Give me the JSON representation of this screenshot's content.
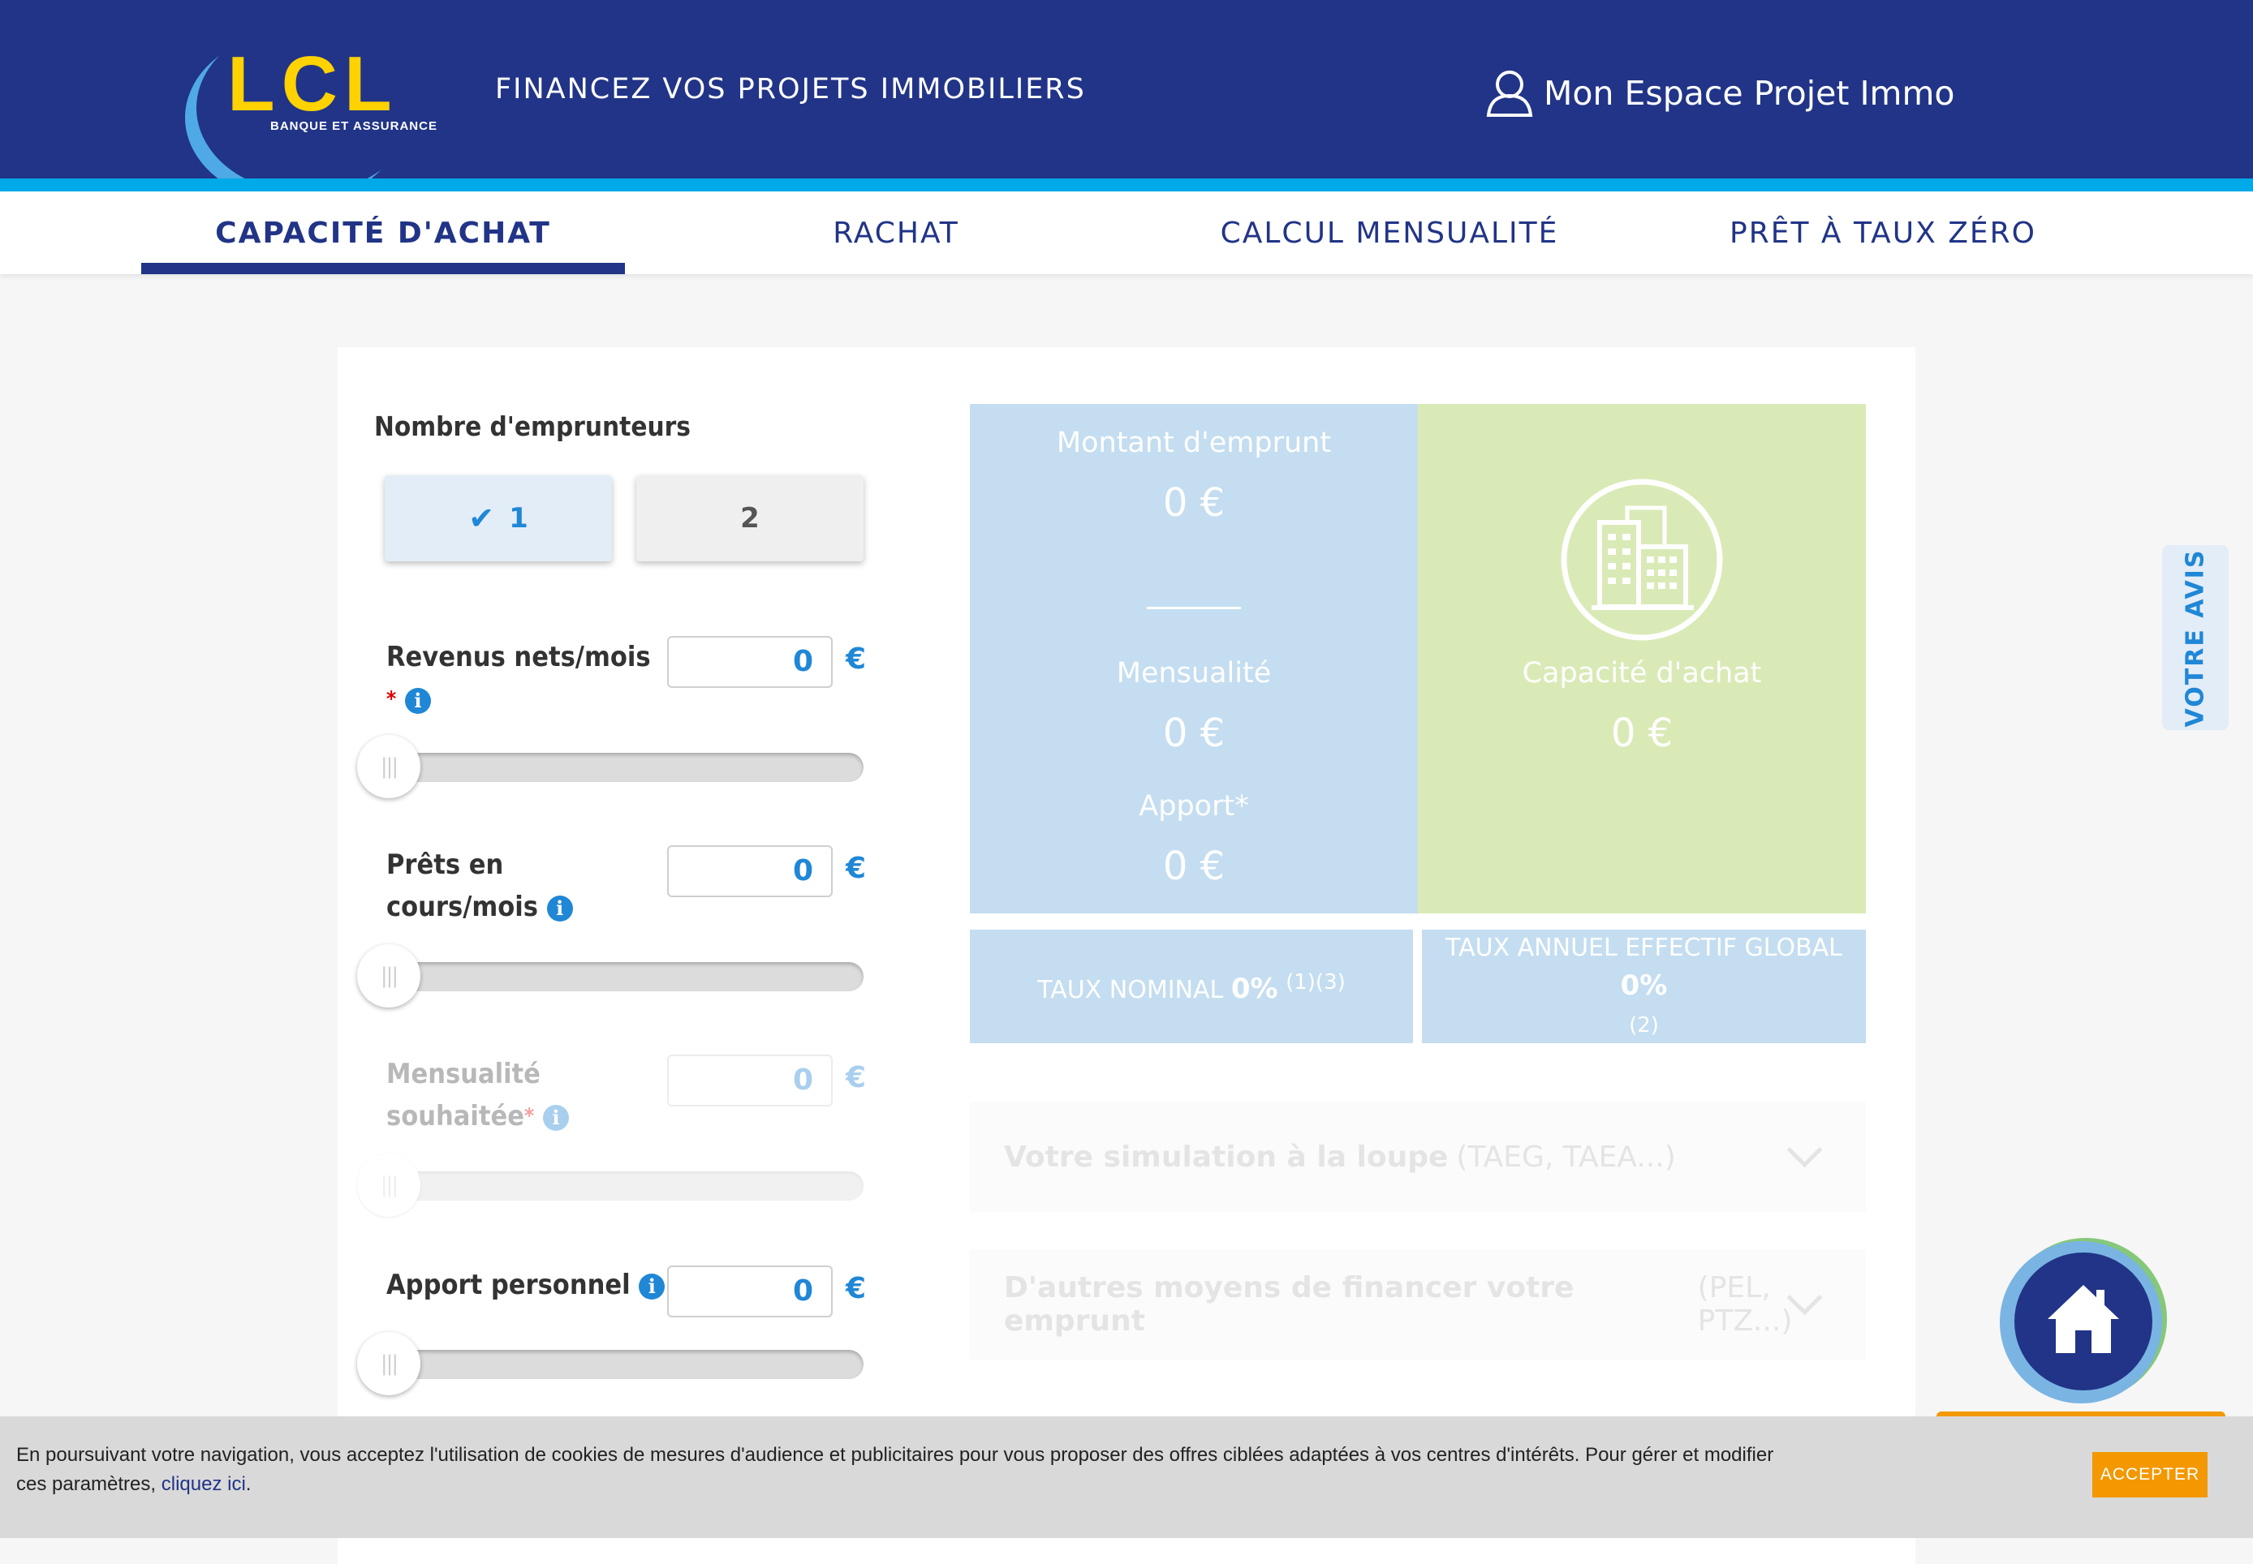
{
  "header": {
    "logo_text": "LCL",
    "logo_subtitle": "BANQUE ET ASSURANCE",
    "title": "FINANCEZ VOS PROJETS IMMOBILIERS",
    "account_link": "Mon Espace Projet Immo"
  },
  "tabs": [
    {
      "label": "CAPACITÉ D'ACHAT",
      "active": true
    },
    {
      "label": "RACHAT",
      "active": false
    },
    {
      "label": "CALCUL MENSUALITÉ",
      "active": false
    },
    {
      "label": "PRÊT À TAUX ZÉRO",
      "active": false
    }
  ],
  "form": {
    "borrowers_label": "Nombre d'emprunteurs",
    "borrower_options": [
      "1",
      "2"
    ],
    "borrower_selected": "1",
    "currency": "€",
    "income": {
      "label": "Revenus nets/mois",
      "required_mark": "*",
      "value": "0",
      "slider_level": 0
    },
    "loans": {
      "label_line1": "Prêts en",
      "label_line2": "cours/mois",
      "value": "0",
      "slider_level": 0
    },
    "monthly": {
      "label_line1": "Mensualité",
      "label_line2": "souhaitée",
      "required_mark": "*",
      "value": "0",
      "slider_level": 0,
      "disabled": true
    },
    "contribution": {
      "label": "Apport personnel",
      "value": "0",
      "slider_level": 0
    }
  },
  "results": {
    "loan_amount_label": "Montant d'emprunt",
    "loan_amount_value": "0 €",
    "monthly_label": "Mensualité",
    "monthly_value": "0 €",
    "contribution_label": "Apport*",
    "contribution_value": "0 €",
    "capacity_label": "Capacité d'achat",
    "capacity_value": "0 €",
    "nominal_rate_label": "TAUX NOMINAL",
    "nominal_rate_value": "0%",
    "nominal_rate_note": "(1)(3)",
    "taeg_label": "TAUX ANNUEL EFFECTIF GLOBAL",
    "taeg_value": "0%",
    "taeg_note": "(2)",
    "colors": {
      "blue_panel": "#c4ddf0",
      "green_panel": "#d9eab6"
    }
  },
  "accordions": [
    {
      "title": "Votre simulation à la loupe",
      "detail": "(TAEG, TAEA...)"
    },
    {
      "title": "D'autres moyens de financer votre emprunt",
      "detail": "(PEL, PTZ...)"
    }
  ],
  "side_tab": "VOTRE AVIS",
  "cookie": {
    "text": "En poursuivant votre navigation, vous acceptez l'utilisation de cookies de mesures d'audience et publicitaires pour vous proposer des offres ciblées adaptées à vos centres d'intérêts. Pour gérer et modifier ces paramètres,",
    "link": "cliquez ici",
    "text_end": ".",
    "accept": "ACCEPTER"
  },
  "colors": {
    "brand_navy": "#213487",
    "accent_cyan": "#00a9e8",
    "accent_blue": "#1f87d6",
    "cta_orange": "#f39800"
  }
}
